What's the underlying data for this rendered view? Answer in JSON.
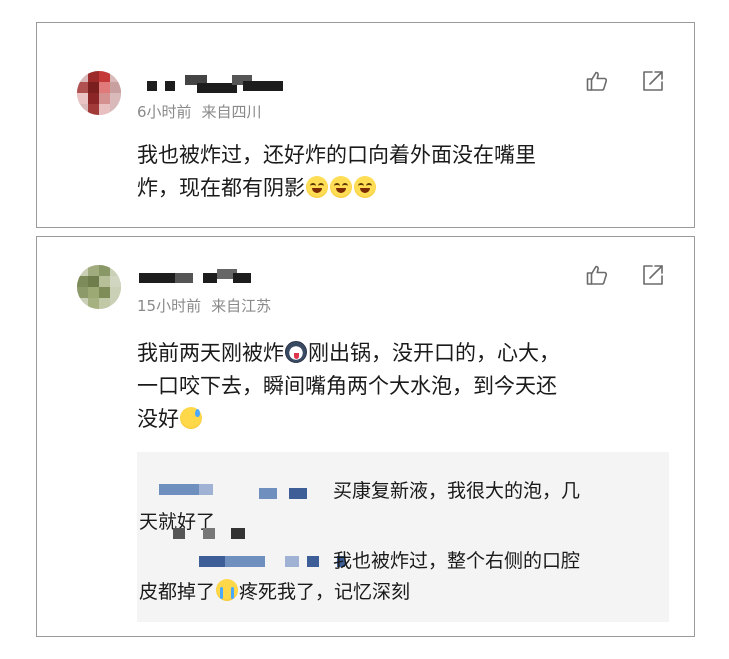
{
  "comments": [
    {
      "time": "6小时前",
      "location": "来自四川",
      "text_line1": "我也被炸过，还好炸的口向着外面没在嘴里",
      "text_line2": "炸，现在都有阴影"
    },
    {
      "time": "15小时前",
      "location": "来自江苏",
      "text_a": "我前两天刚被炸",
      "text_b": "刚出锅，没开口的，心大，",
      "text_line2": "一口咬下去，瞬间嘴角两个大水泡，到今天还",
      "text_line3": "没好",
      "replies": [
        {
          "text_line1": "买康复新液，我很大的泡，几",
          "text_line2": "天就好了"
        },
        {
          "text_line1": "我也被炸过，整个右侧的口腔",
          "text_line2a": "皮都掉了",
          "text_line2b": "疼死我了，记忆深刻"
        }
      ]
    }
  ],
  "icons": {
    "like": "thumbs-up-icon",
    "share": "share-icon"
  },
  "colors": {
    "meta": "#8a8a8a",
    "reply_bg": "#f4f4f4",
    "border": "#9a9a9a"
  }
}
